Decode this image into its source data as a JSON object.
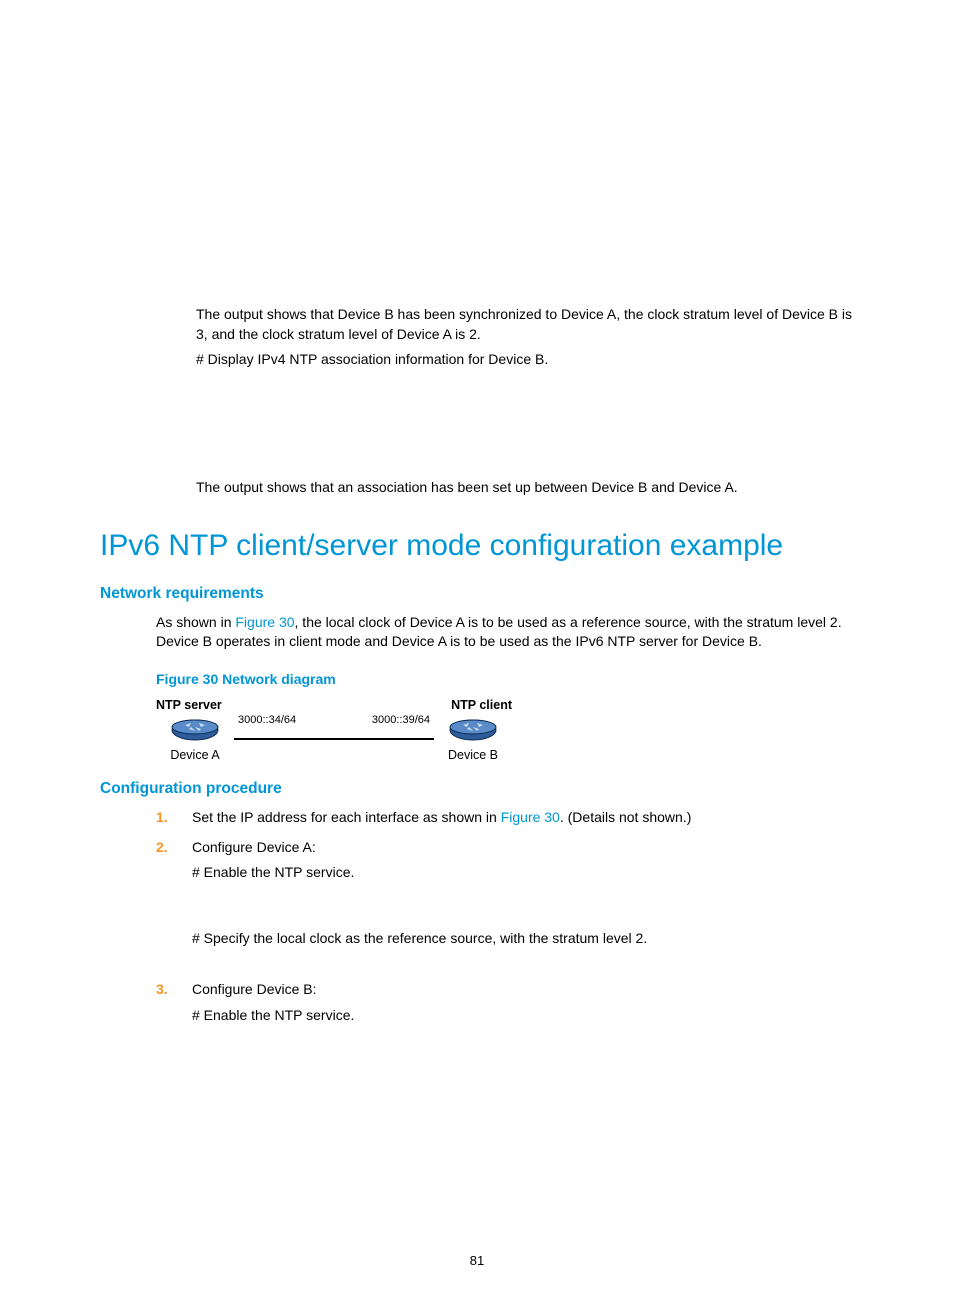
{
  "intro": {
    "para1": "The output shows that Device B has been synchronized to Device A, the clock stratum level of Device B is 3, and the clock stratum level of Device A is 2.",
    "para2": "# Display IPv4 NTP association information for Device B.",
    "para3": "The output shows that an association has been set up between Device B and Device A."
  },
  "heading": "IPv6 NTP client/server mode configuration example",
  "sections": {
    "netreq": {
      "title": "Network requirements",
      "body_pre": "As shown in ",
      "body_link": "Figure 30",
      "body_post": ", the local clock of Device A is to be used as a reference source, with the stratum level 2. Device B operates in client mode and Device A is to be used as the IPv6 NTP server for Device B.",
      "figure_caption": "Figure 30 Network diagram",
      "diagram": {
        "server_label": "NTP server",
        "client_label": "NTP client",
        "ip_a": "3000::34/64",
        "ip_b": "3000::39/64",
        "device_a": "Device A",
        "device_b": "Device B"
      }
    },
    "proc": {
      "title": "Configuration procedure",
      "steps": [
        {
          "num": "1.",
          "text_pre": "Set the IP address for each interface as shown in ",
          "link": "Figure 30",
          "text_post": ". (Details not shown.)"
        },
        {
          "num": "2.",
          "text": "Configure Device A:",
          "sub1": "# Enable the NTP service.",
          "sub2": "# Specify the local clock as the reference source, with the stratum level 2."
        },
        {
          "num": "3.",
          "text": "Configure Device B:",
          "sub1": "# Enable the NTP service."
        }
      ]
    }
  },
  "page_number": "81"
}
